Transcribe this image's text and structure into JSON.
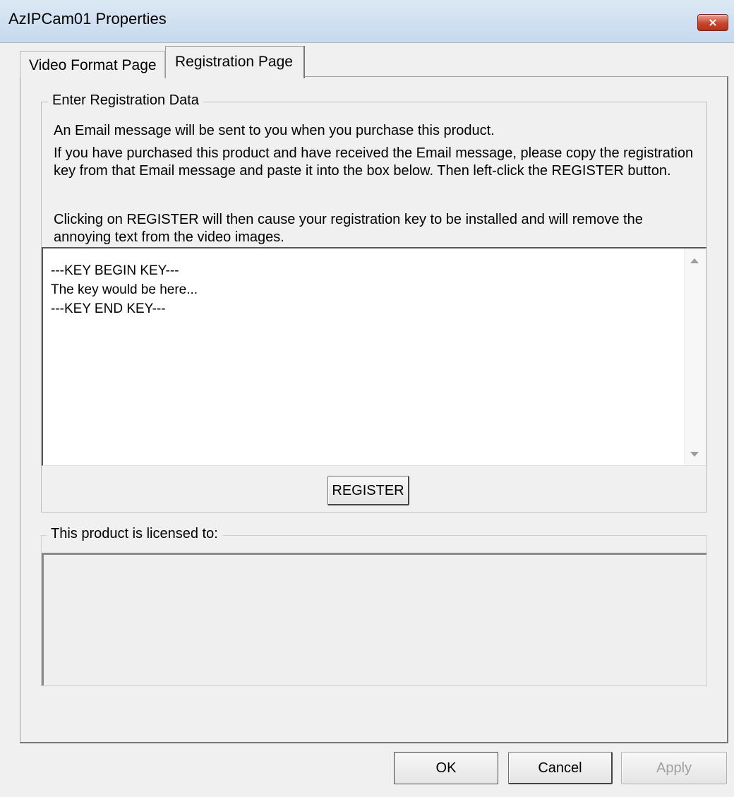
{
  "window": {
    "title": "AzIPCam01 Properties",
    "close_label": "×"
  },
  "tabs": [
    {
      "label": "Video Format Page",
      "active": false
    },
    {
      "label": "Registration Page",
      "active": true
    }
  ],
  "registration_group": {
    "legend": "Enter Registration Data",
    "paragraphs": [
      "An Email message will be sent to you when you purchase this product.",
      "If you have purchased this product and have received the Email message, please copy the registration key from that Email message and paste it into the box below.  Then left-click the REGISTER button.",
      "Clicking on REGISTER will then cause your registration key to be installed and will remove the annoying text from the video images."
    ],
    "key_text": "---KEY BEGIN KEY---\nThe key would be here...\n---KEY END KEY---",
    "register_label": "REGISTER"
  },
  "license_group": {
    "legend": "This product is licensed to:",
    "value": ""
  },
  "footer": {
    "ok_label": "OK",
    "cancel_label": "Cancel",
    "apply_label": "Apply",
    "apply_enabled": false
  },
  "icons": {
    "close": "close-icon",
    "scroll_up": "scroll-up-arrow-icon",
    "scroll_down": "scroll-down-arrow-icon"
  }
}
